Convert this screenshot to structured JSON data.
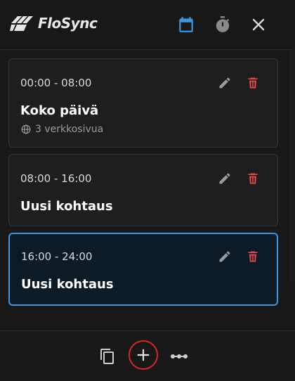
{
  "header": {
    "app_name": "FloSync",
    "icons": {
      "calendar": "calendar-icon",
      "timer": "timer-icon",
      "close": "close-icon"
    },
    "accent_color": "#3b96de"
  },
  "cards": [
    {
      "time_range": "00:00 - 08:00",
      "title": "Koko päivä",
      "meta": "3 verkkosivua",
      "selected": false
    },
    {
      "time_range": "08:00 - 16:00",
      "title": "Uusi kohtaus",
      "selected": false
    },
    {
      "time_range": "16:00 - 24:00",
      "title": "Uusi kohtaus",
      "selected": true
    }
  ],
  "card_actions": {
    "edit_icon": "pencil-icon",
    "delete_icon": "trash-icon",
    "delete_color": "#e5484d"
  },
  "footer": {
    "icons": [
      "copy-icon",
      "plus-icon",
      "more-icon"
    ],
    "highlight_color": "#d7252a"
  }
}
